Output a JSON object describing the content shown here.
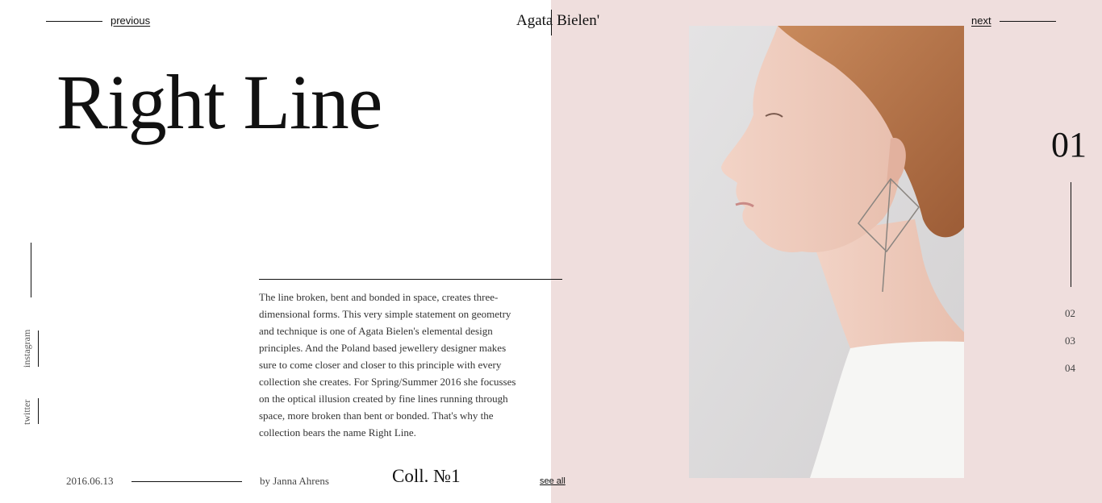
{
  "nav": {
    "previous": "previous",
    "next": "next"
  },
  "brand": {
    "name": "Agata Bielen'"
  },
  "hero": {
    "title": "Right Line"
  },
  "social": {
    "instagram": "instagram",
    "twitter": "twitter"
  },
  "article": {
    "body": "The line broken, bent and bonded in space, creates three-dimensional forms. This very simple statement on geometry and technique is one of Agata Bielen's elemental design principles. And the Poland based jewellery designer makes sure to come closer and closer to this principle with every collection she creates. For Spring/Summer 2016 she focusses on the optical illusion created by fine lines running through space, more broken than bent or bonded. That's why the collection bears the name Right Line.",
    "date": "2016.06.13",
    "author": "by Janna Ahrens",
    "collection": "Coll. №1",
    "see_all": "see all"
  },
  "pager": {
    "current": "01",
    "pages": [
      "02",
      "03",
      "04"
    ]
  },
  "colors": {
    "panel": "#efdedd",
    "ink": "#111111"
  }
}
